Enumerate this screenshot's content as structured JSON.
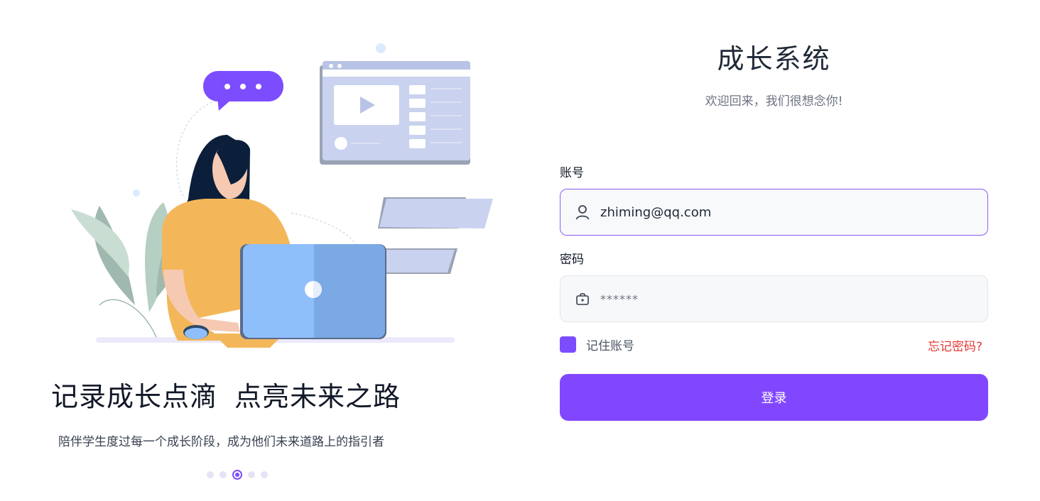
{
  "hero": {
    "slogan_part1": "记录成长点滴",
    "slogan_part2": "点亮未来之路",
    "subtitle": "陪伴学生度过每一个成长阶段，成为他们未来道路上的指引者",
    "carousel": {
      "total": 5,
      "active_index": 2
    }
  },
  "login": {
    "title": "成长系统",
    "welcome": "欢迎回来，我们很想念你!",
    "account_label": "账号",
    "account_value": "zhiming@qq.com",
    "password_label": "密码",
    "password_value": "******",
    "remember_label": "记住账号",
    "remember_checked": true,
    "forgot_label": "忘记密码?",
    "submit_label": "登录"
  },
  "icons": {
    "account": "user-icon",
    "password": "lock-icon"
  },
  "colors": {
    "accent": "#8147ff",
    "danger": "#e53935",
    "illustration_blue": "#8fbffb",
    "illustration_yellow": "#f3b75a"
  }
}
